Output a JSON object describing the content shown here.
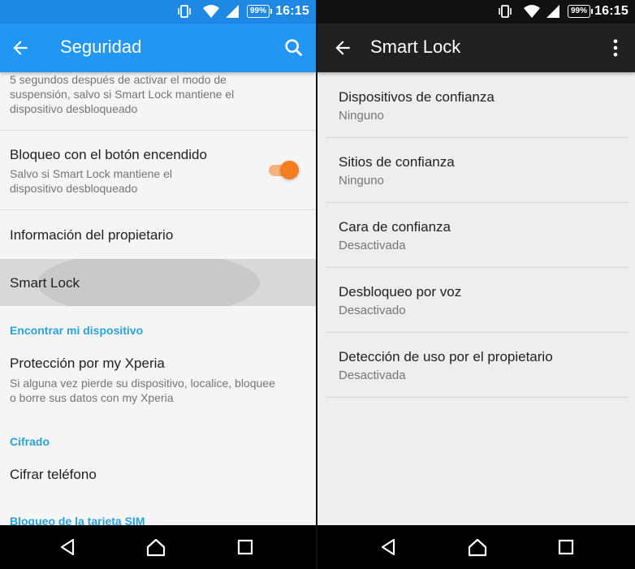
{
  "status": {
    "left": {
      "battery": "99%",
      "time": "16:15"
    },
    "right": {
      "battery": "99%",
      "time": "16:15"
    }
  },
  "left_screen": {
    "title": "Seguridad",
    "items": {
      "lock_timeout_desc_l1": "5 segundos después de activar el modo de",
      "lock_timeout_desc_l2": "suspensión, salvo si Smart Lock mantiene el",
      "lock_timeout_desc_l3": "dispositivo desbloqueado",
      "power_lock_title": "Bloqueo con el botón encendido",
      "power_lock_sub_l1": "Salvo si Smart Lock mantiene el",
      "power_lock_sub_l2": "dispositivo desbloqueado",
      "owner_info": "Información del propietario",
      "smart_lock": "Smart Lock",
      "section_find": "Encontrar mi dispositivo",
      "xperia_title": "Protección por my Xperia",
      "xperia_sub_l1": "Si alguna vez pierde su dispositivo, localice, bloquee",
      "xperia_sub_l2": "o borre sus datos con my Xperia",
      "section_cipher": "Cifrado",
      "encrypt_phone": "Cifrar teléfono",
      "section_sim": "Bloqueo de la tarjeta SIM"
    },
    "power_lock_toggle_on": true
  },
  "right_screen": {
    "title": "Smart Lock",
    "items": [
      {
        "title": "Dispositivos de confianza",
        "sub": "Ninguno"
      },
      {
        "title": "Sitios de confianza",
        "sub": "Ninguno"
      },
      {
        "title": "Cara de confianza",
        "sub": "Desactivada"
      },
      {
        "title": "Desbloqueo por voz",
        "sub": "Desactivado"
      },
      {
        "title": "Detección de uso por el propietario",
        "sub": "Desactivada"
      }
    ]
  },
  "colors": {
    "accent_blue": "#2196f3",
    "status_blue": "#1e88e5",
    "section_header": "#29a3dd",
    "toggle_orange": "#f57c1f",
    "dark_appbar": "#212121"
  },
  "icons": [
    "back-arrow-icon",
    "search-icon",
    "more-vert-icon",
    "vibrate-icon",
    "wifi-icon",
    "signal-icon",
    "battery-icon",
    "nav-back-icon",
    "nav-home-icon",
    "nav-recents-icon"
  ]
}
